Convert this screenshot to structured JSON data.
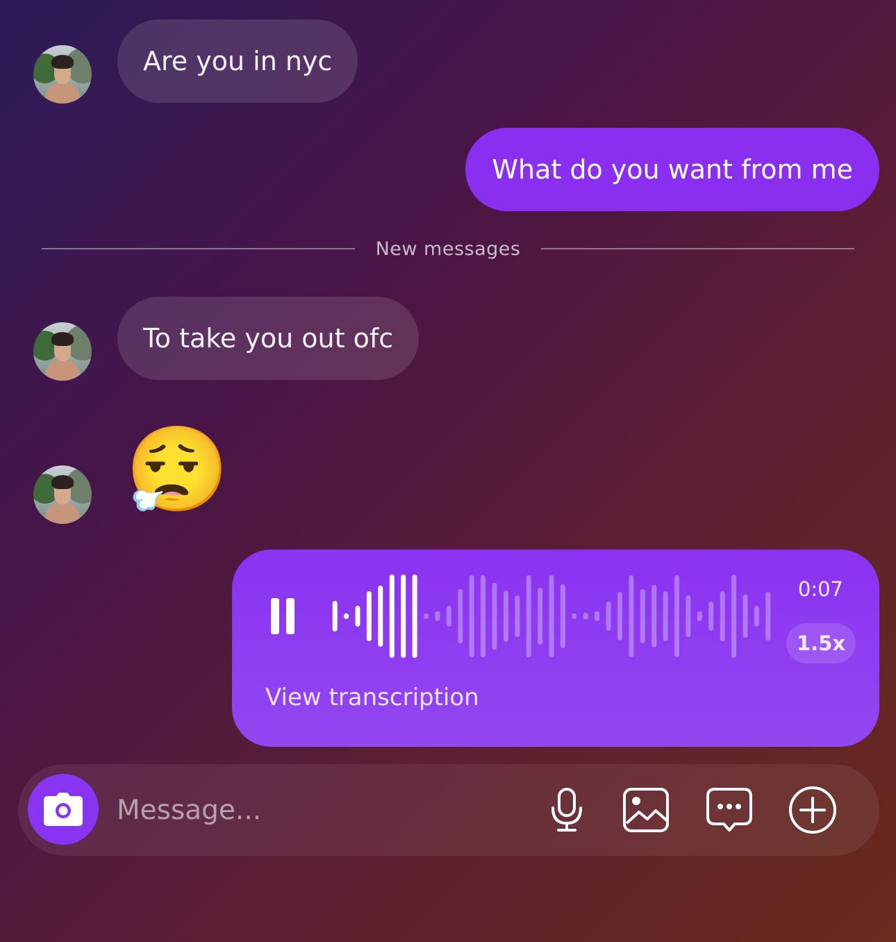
{
  "messages": {
    "incoming_1": "Are you in nyc",
    "outgoing_1": "What do you want from me",
    "divider": "New messages",
    "incoming_2": "To take you out ofc",
    "incoming_3_emoji": "😮‍💨",
    "voice": {
      "duration": "0:07",
      "speed": "1.5x",
      "transcription_link": "View transcription",
      "played_fraction": 0.2
    }
  },
  "composer": {
    "placeholder": "Message...",
    "icons": [
      "camera-icon",
      "microphone-icon",
      "gallery-icon",
      "message-options-icon",
      "add-icon"
    ]
  },
  "colors": {
    "accent": "#8a2ef0",
    "voice_bubble": "#9247ef",
    "incoming_bubble": "rgba(255,255,255,0.12)"
  }
}
